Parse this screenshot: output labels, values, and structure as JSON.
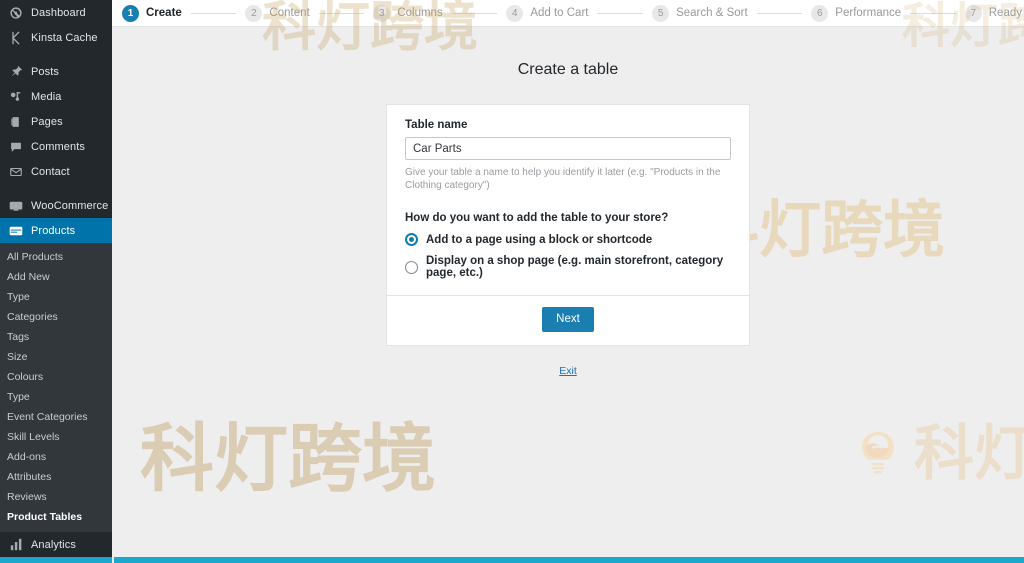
{
  "sidebar": {
    "top_items": [
      {
        "label": "Dashboard",
        "icon": "dashboard-icon"
      },
      {
        "label": "Kinsta Cache",
        "icon": "kinsta-k-icon"
      }
    ],
    "content_items": [
      {
        "label": "Posts",
        "icon": "pin-icon"
      },
      {
        "label": "Media",
        "icon": "media-icon"
      },
      {
        "label": "Pages",
        "icon": "pages-icon"
      },
      {
        "label": "Comments",
        "icon": "comment-icon"
      },
      {
        "label": "Contact",
        "icon": "envelope-icon"
      }
    ],
    "store_items": [
      {
        "label": "WooCommerce",
        "icon": "woocommerce-icon"
      },
      {
        "label": "Products",
        "icon": "products-icon",
        "active": true
      }
    ],
    "submenu": [
      {
        "label": "All Products"
      },
      {
        "label": "Add New"
      },
      {
        "label": "Type"
      },
      {
        "label": "Categories"
      },
      {
        "label": "Tags"
      },
      {
        "label": "Size"
      },
      {
        "label": "Colours"
      },
      {
        "label": "Type"
      },
      {
        "label": "Event Categories"
      },
      {
        "label": "Skill Levels"
      },
      {
        "label": "Add-ons"
      },
      {
        "label": "Attributes"
      },
      {
        "label": "Reviews"
      },
      {
        "label": "Product Tables",
        "current": true
      }
    ],
    "bottom_items": [
      {
        "label": "Analytics",
        "icon": "bar-chart-icon"
      }
    ]
  },
  "stepper": {
    "steps": [
      {
        "num": "1",
        "label": "Create",
        "state": "current"
      },
      {
        "num": "2",
        "label": "Content",
        "state": "upcoming"
      },
      {
        "num": "3",
        "label": "Columns",
        "state": "upcoming"
      },
      {
        "num": "4",
        "label": "Add to Cart",
        "state": "upcoming"
      },
      {
        "num": "5",
        "label": "Search & Sort",
        "state": "upcoming"
      },
      {
        "num": "6",
        "label": "Performance",
        "state": "upcoming"
      },
      {
        "num": "7",
        "label": "Ready",
        "state": "upcoming"
      }
    ]
  },
  "page": {
    "title": "Create a table",
    "table_name_label": "Table name",
    "table_name_value": "Car Parts",
    "table_name_placeholder": "Table name",
    "help_text": "Give your table a name to help you identify it later (e.g. \"Products in the Clothing category\")",
    "question": "How do you want to add the table to your store?",
    "options": [
      {
        "label": "Add to a page using a block or shortcode",
        "checked": true
      },
      {
        "label": "Display on a shop page (e.g. main storefront, category page, etc.)",
        "checked": false
      }
    ],
    "next_label": "Next",
    "exit_label": "Exit"
  },
  "watermarks": {
    "text": "科灯跨境",
    "logo_name": "lightbulb-logo",
    "color": "#e6c48c"
  },
  "colors": {
    "sidebar_bg": "#23282d",
    "submenu_bg": "#32373c",
    "accent_blue": "#0073aa",
    "button_blue": "#1a7eb0",
    "content_bg": "#eeeeee",
    "bottom_bar": "#1ba8cc"
  }
}
